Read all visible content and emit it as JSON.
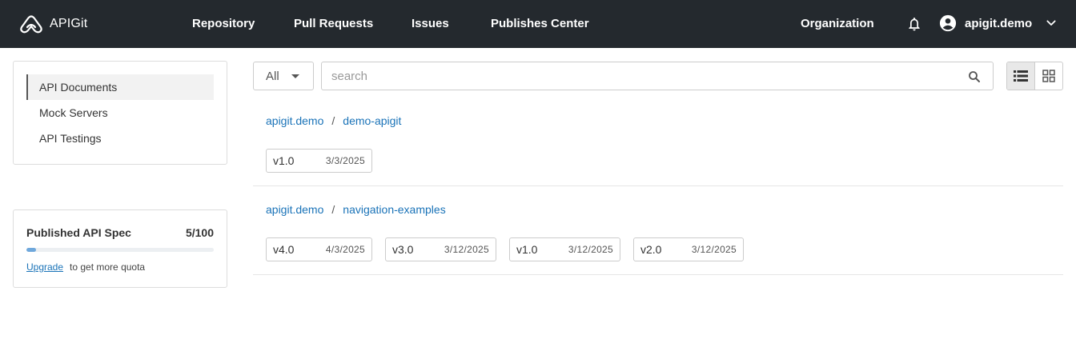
{
  "header": {
    "brand": "APIGit",
    "nav": [
      {
        "label": "Repository"
      },
      {
        "label": "Pull Requests"
      },
      {
        "label": "Issues"
      },
      {
        "label": "Publishes Center"
      }
    ],
    "organization": "Organization",
    "username": "apigit.demo",
    "icons": {
      "logo": "apigit-logo-icon",
      "bell": "bell-icon",
      "avatar": "account-circle-icon",
      "chevron": "chevron-down-icon"
    }
  },
  "sidebar": {
    "items": [
      {
        "label": "API Documents",
        "active": true
      },
      {
        "label": "Mock Servers",
        "active": false
      },
      {
        "label": "API Testings",
        "active": false
      }
    ]
  },
  "quota": {
    "title": "Published API Spec",
    "count": "5/100",
    "used_fraction": 0.05,
    "upgrade_label": "Upgrade",
    "suffix": "to get more quota"
  },
  "toolbar": {
    "filter_value": "All",
    "search_placeholder": "search",
    "view_modes": [
      "list-view-icon",
      "grid-view-icon"
    ],
    "active_view": "list"
  },
  "colors": {
    "topbar": "#24292e",
    "link": "#1a73b8",
    "progress": "#6fa8dc"
  },
  "repos": [
    {
      "owner": "apigit.demo",
      "separator": "/",
      "name": "demo-apigit",
      "versions": [
        {
          "ver": "v1.0",
          "date": "3/3/2025"
        }
      ]
    },
    {
      "owner": "apigit.demo",
      "separator": "/",
      "name": "navigation-examples",
      "versions": [
        {
          "ver": "v4.0",
          "date": "4/3/2025"
        },
        {
          "ver": "v3.0",
          "date": "3/12/2025"
        },
        {
          "ver": "v1.0",
          "date": "3/12/2025"
        },
        {
          "ver": "v2.0",
          "date": "3/12/2025"
        }
      ]
    }
  ]
}
